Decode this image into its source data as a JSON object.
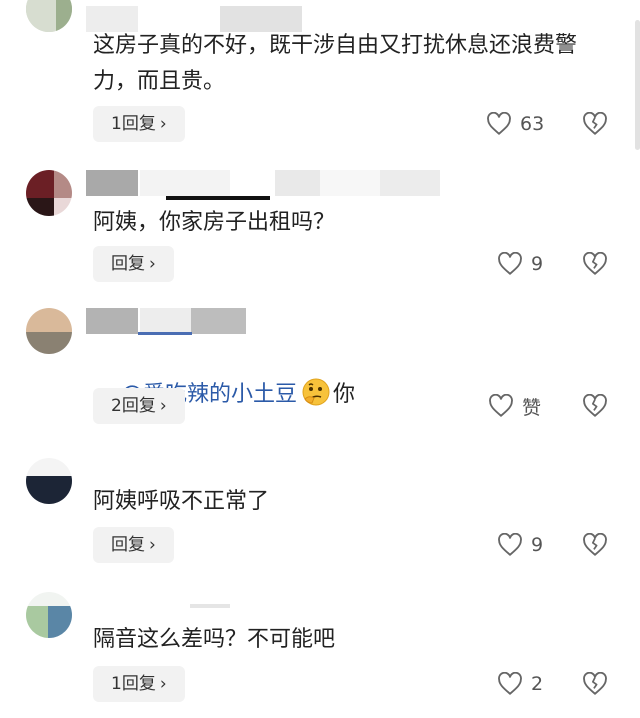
{
  "comments": [
    {
      "text": "这房子真的不好，既干涉自由又打扰休息还浪费警力，而且贵。",
      "reply_label": "1回复",
      "like_count": "63"
    },
    {
      "text": "阿姨，你家房子出租吗？",
      "reply_label": "回复",
      "like_count": "9"
    },
    {
      "mention": "@爱吃辣的小土豆",
      "text_after": "你",
      "reply_label": "2回复",
      "like_count": "赞"
    },
    {
      "text": "阿姨呼吸不正常了",
      "reply_label": "回复",
      "like_count": "9"
    },
    {
      "text": "隔音这么差吗？不可能吧",
      "reply_label": "1回复",
      "like_count": "2"
    }
  ],
  "icons": {
    "like": "heart-outline-icon",
    "dislike": "broken-heart-icon",
    "chevron": "chevron-right-icon"
  },
  "colors": {
    "mention": "#2b5aa8",
    "reply_bg": "#f2f2f2",
    "icon": "#666666"
  }
}
